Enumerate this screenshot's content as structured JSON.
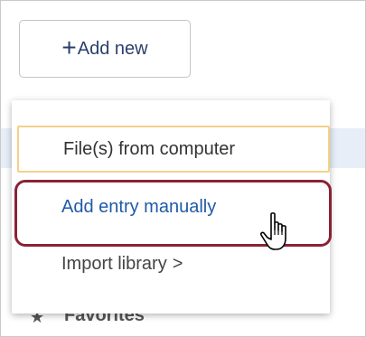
{
  "toolbar": {
    "add_new_plus": "+",
    "add_new_label": "Add new"
  },
  "menu": {
    "items": [
      {
        "label": "File(s) from computer"
      },
      {
        "label": "Add entry manually"
      },
      {
        "label": "Import library",
        "chevron": ">"
      }
    ]
  },
  "background": {
    "obscured_item": "Favorites"
  },
  "colors": {
    "link_blue": "#1f5aa8",
    "callout_border": "#8b2236",
    "focus_border": "#f2d18b",
    "row_highlight": "#e7eef8"
  },
  "icons": {
    "add": "plus-icon",
    "submenu": "chevron-right-icon",
    "pointer": "hand-pointer-cursor-icon",
    "favorites": "star-icon"
  }
}
